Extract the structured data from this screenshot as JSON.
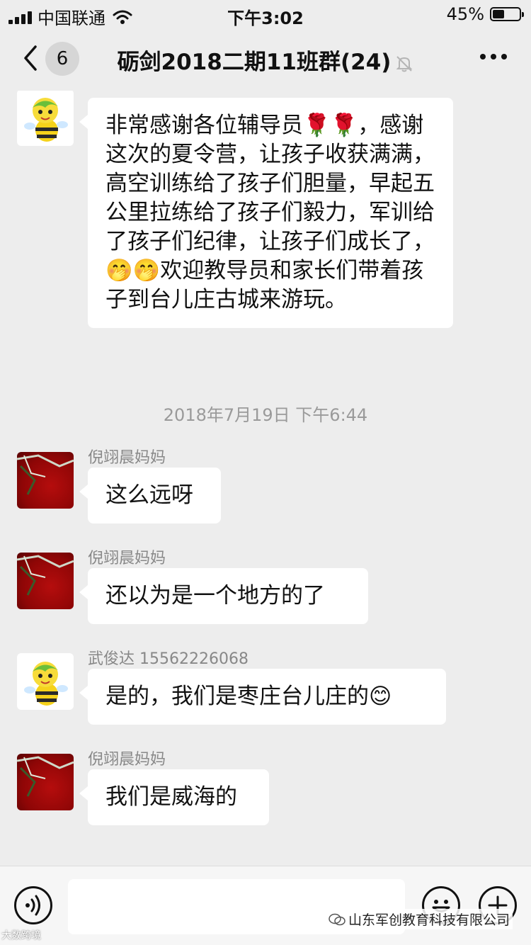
{
  "status": {
    "carrier": "中国联通",
    "time": "下午3:02",
    "battery": "45%",
    "battery_level": 0.45
  },
  "nav": {
    "unread_count": "6",
    "title": "砺剑2018二期11班群(24)"
  },
  "chat": {
    "timestamp": "2018年7月19日 下午6:44",
    "messages": [
      {
        "sender": "",
        "text": "非常感谢各位辅导员🌹🌹，感谢这次的夏令营，让孩子收获满满，高空训练给了孩子们胆量，早起五公里拉练给了孩子们毅力，军训给了孩子们纪律，让孩子们成长了，🤭🤭欢迎教导员和家长们带着孩子到台儿庄古城来游玩。"
      },
      {
        "sender": "倪翊晨妈妈",
        "text": "这么远呀"
      },
      {
        "sender": "倪翊晨妈妈",
        "text": "还以为是一个地方的了"
      },
      {
        "sender": "武俊达  15562226068",
        "text": "是的，我们是枣庄台儿庄的😊"
      },
      {
        "sender": "倪翊晨妈妈",
        "text": "我们是威海的"
      }
    ]
  },
  "input": {
    "value": ""
  },
  "watermark": {
    "text": "山东军创教育科技有限公司",
    "corner_text": "大数跨境"
  }
}
